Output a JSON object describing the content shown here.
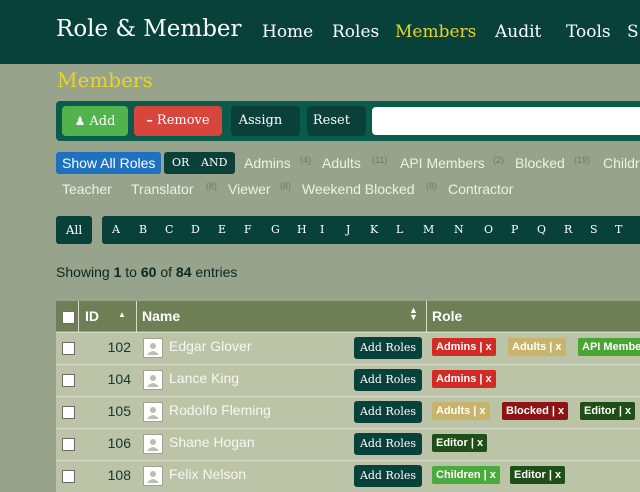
{
  "brand": "Role & Member",
  "nav": [
    "Home",
    "Roles",
    "Members",
    "Audit",
    "Tools",
    "S"
  ],
  "page_title": "Members",
  "toolbar": {
    "add": "Add",
    "remove": "Remove",
    "assign": "Assign",
    "reset": "Reset",
    "search_value": ""
  },
  "filter": {
    "show_all": "Show All Roles",
    "or": "OR",
    "and": "AND",
    "roles": [
      {
        "label": "Admins",
        "count": "(4)"
      },
      {
        "label": "Adults",
        "count": "(11)"
      },
      {
        "label": "API Members",
        "count": "(2)"
      },
      {
        "label": "Blocked",
        "count": "(19)"
      },
      {
        "label": "Childr",
        "count": ""
      },
      {
        "label": "Teacher",
        "count": ""
      },
      {
        "label": "Translator",
        "count": "(8)"
      },
      {
        "label": "Viewer",
        "count": "(8)"
      },
      {
        "label": "Weekend Blocked",
        "count": "(8)"
      },
      {
        "label": "Contractor",
        "count": ""
      }
    ]
  },
  "alphabet": {
    "all": "All",
    "letters": [
      "A",
      "B",
      "C",
      "D",
      "E",
      "F",
      "G",
      "H",
      "I",
      "J",
      "K",
      "L",
      "M",
      "N",
      "O",
      "P",
      "Q",
      "R",
      "S",
      "T"
    ]
  },
  "showing": {
    "prefix": "Showing",
    "from": "1",
    "to_word": "to",
    "to": "60",
    "of_word": "of",
    "total": "84",
    "suffix": "entries"
  },
  "table": {
    "headers": {
      "id": "ID",
      "name": "Name",
      "role": "Role"
    },
    "add_roles": "Add Roles",
    "rows": [
      {
        "id": "102",
        "name": "Edgar Glover",
        "roles": [
          "Admins | x",
          "Adults | x",
          "API Membe"
        ]
      },
      {
        "id": "104",
        "name": "Lance King",
        "roles": [
          "Admins | x"
        ]
      },
      {
        "id": "105",
        "name": "Rodolfo Fleming",
        "roles": [
          "Adults | x",
          "Blocked | x",
          "Editor | x"
        ]
      },
      {
        "id": "106",
        "name": "Shane Hogan",
        "roles": [
          "Editor | x"
        ]
      },
      {
        "id": "108",
        "name": "Felix Nelson",
        "roles": [
          "Children | x",
          "Editor | x"
        ]
      }
    ]
  },
  "colors": {
    "Admins": "#d22a24",
    "Adults": "#c8b36a",
    "API": "#49a533",
    "Blocked": "#8e1414",
    "Editor": "#1f4f17",
    "Children": "#4aaa3e"
  }
}
